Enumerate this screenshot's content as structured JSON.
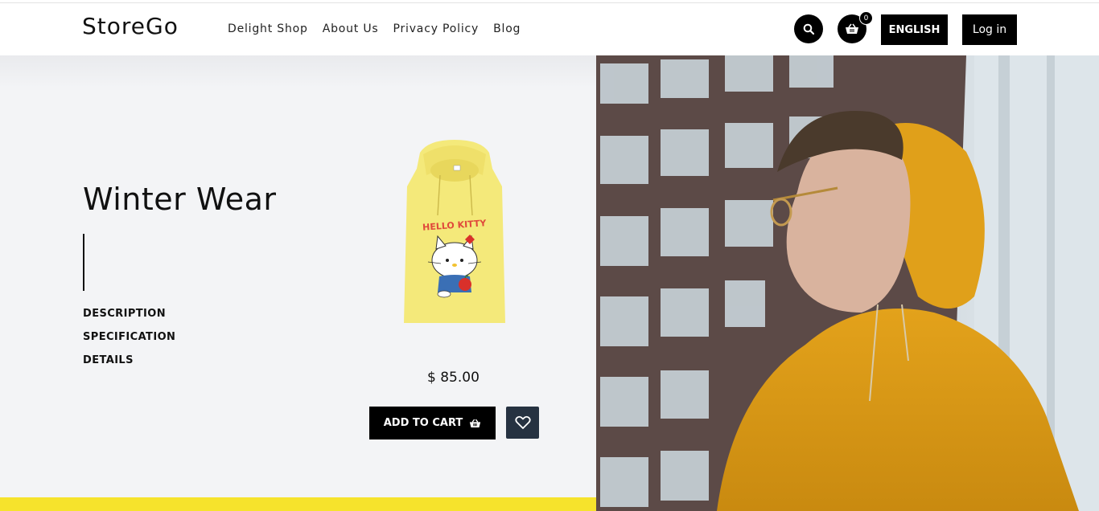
{
  "brand": {
    "logo": "StoreGo"
  },
  "nav": {
    "items": [
      "Delight Shop",
      "About Us",
      "Privacy Policy",
      "Blog"
    ]
  },
  "header": {
    "search_icon": "search-icon",
    "cart_icon": "basket-icon",
    "cart_count": "0",
    "language_label": "ENGLISH",
    "login_label": "Log in"
  },
  "product": {
    "title": "Winter Wear",
    "tabs": [
      "DESCRIPTION",
      "SPECIFICATION",
      "DETAILS"
    ],
    "price": "$ 85.00",
    "add_to_cart_label": "ADD TO CART",
    "add_to_cart_icon": "basket-icon",
    "wishlist_icon": "heart-icon",
    "image_print_text": "HELLO KITTY"
  },
  "colors": {
    "accent_yellow": "#f6e32c",
    "button_black": "#000000",
    "wishlist_bg": "#263241",
    "panel_bg": "#f3f4f6"
  }
}
